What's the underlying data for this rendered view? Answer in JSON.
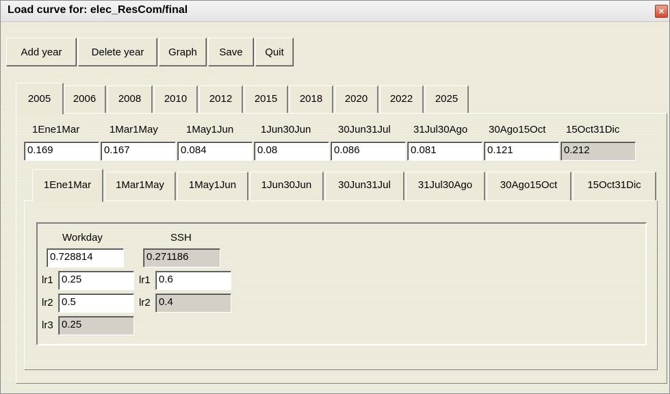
{
  "window": {
    "title": "Load curve for: elec_ResCom/final",
    "close_glyph": "×"
  },
  "toolbar": {
    "buttons": [
      "Add year",
      "Delete year",
      "Graph",
      "Save",
      "Quit"
    ]
  },
  "year_tabs": {
    "items": [
      "2005",
      "2006",
      "2008",
      "2010",
      "2012",
      "2015",
      "2018",
      "2020",
      "2022",
      "2025"
    ],
    "selected": "2005"
  },
  "periods": {
    "labels": [
      "1Ene1Mar",
      "1Mar1May",
      "1May1Jun",
      "1Jun30Jun",
      "30Jun31Jul",
      "31Jul30Ago",
      "30Ago15Oct",
      "15Oct31Dic"
    ],
    "values": [
      "0.169",
      "0.167",
      "0.084",
      "0.08",
      "0.086",
      "0.081",
      "0.121",
      "0.212"
    ]
  },
  "period_tabs": {
    "items": [
      "1Ene1Mar",
      "1Mar1May",
      "1May1Jun",
      "1Jun30Jun",
      "30Jun31Jul",
      "31Jul30Ago",
      "30Ago15Oct",
      "15Oct31Dic"
    ],
    "selected": "1Ene1Mar"
  },
  "detail": {
    "workday": {
      "label": "Workday",
      "value": "0.728814",
      "rows": [
        {
          "label": "lr1",
          "value": "0.25"
        },
        {
          "label": "lr2",
          "value": "0.5"
        },
        {
          "label": "lr3",
          "value": "0.25"
        }
      ]
    },
    "ssh": {
      "label": "SSH",
      "value": "0.271186",
      "rows": [
        {
          "label": "lr1",
          "value": "0.6"
        },
        {
          "label": "lr2",
          "value": "0.4"
        }
      ]
    }
  }
}
